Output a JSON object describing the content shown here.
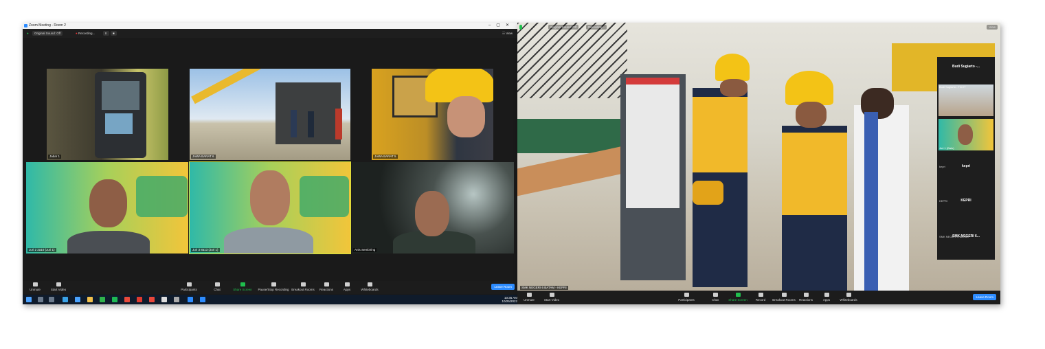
{
  "left_window": {
    "title": "Zoom Meeting - Room 2",
    "top_bar": {
      "sound": "Original Sound: Off",
      "recording": "Recording...",
      "view": "View"
    },
    "tiles": [
      {
        "name": "Jabar 1"
      },
      {
        "name": "JAWA BARAT 6"
      },
      {
        "name": "JAWA BARAT 5"
      },
      {
        "name": "Juri 2 2a10 (Juri 1)"
      },
      {
        "name": "Juri 3 8a13 (Juri 1)"
      },
      {
        "name": "Anis Sembiring"
      }
    ],
    "toolbar": {
      "unmute": "Unmute",
      "start_video": "Start Video",
      "participants": "Participants",
      "participants_count": "6",
      "chat": "Chat",
      "share_screen": "Share Screen",
      "recording": "Pause/Stop Recording",
      "breakout": "Breakout Rooms",
      "reactions": "Reactions",
      "apps": "Apps",
      "whiteboards": "Whiteboards",
      "leave": "Leave Room"
    },
    "clock": {
      "time": "10:36 AM",
      "date": "10/25/2022"
    }
  },
  "right_window": {
    "top_bar": {
      "item1": "Original Sound: Off",
      "item2": "Recording...",
      "view": "View"
    },
    "main_tile_name": "SMK NEGERI 6 BATAM - KEPRI",
    "sidebar": [
      {
        "type": "name",
        "title": "Budi Sugiarto -..."
      },
      {
        "type": "video",
        "name": "Budi Sugiarto - Tim IT"
      },
      {
        "type": "video",
        "name": "Juri 1 (Balo)"
      },
      {
        "type": "name",
        "title": "kepri",
        "sub": "kepri"
      },
      {
        "type": "name",
        "title": "KEPRI",
        "sub": "KEPRI"
      },
      {
        "type": "name",
        "title": "SMK NEGERI 6...",
        "sub": "SMK NEGERI 6 BATAM"
      }
    ],
    "toolbar": {
      "unmute": "Unmute",
      "start_video": "Start Video",
      "participants": "Participants",
      "chat": "Chat",
      "share_screen": "Share Screen",
      "record": "Record",
      "breakout": "Breakout Rooms",
      "reactions": "Reactions",
      "apps": "Apps",
      "whiteboards": "Whiteboards",
      "leave": "Leave Room"
    }
  },
  "colors": {
    "accent": "#2d8cff",
    "share": "#1fbf4d",
    "dark": "#1a1a1a"
  }
}
